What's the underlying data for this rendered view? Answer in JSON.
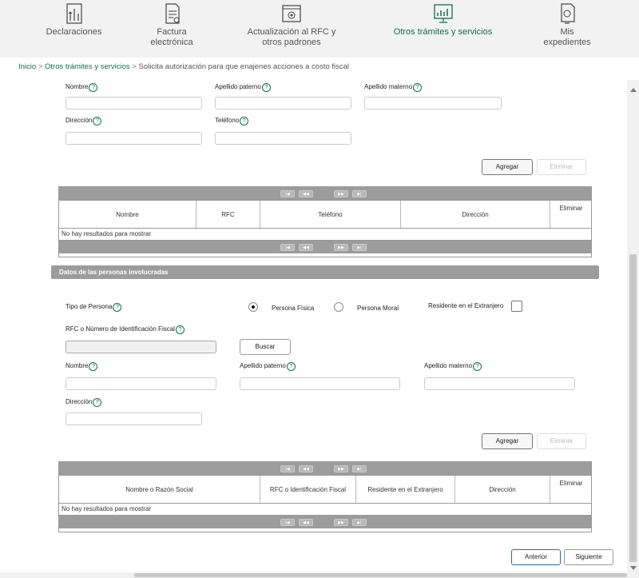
{
  "nav": {
    "items": [
      {
        "label1": "Declaraciones",
        "label2": "",
        "icon": "documents-stack-icon"
      },
      {
        "label1": "Factura",
        "label2": "electrónica",
        "icon": "invoice-icon"
      },
      {
        "label1": "Actualización al RFC y",
        "label2": "otros padrones",
        "icon": "rfc-update-icon"
      },
      {
        "label1": "Otros trámites y servicios",
        "label2": "",
        "icon": "services-monitor-icon"
      },
      {
        "label1": "Mis",
        "label2": "expedientes",
        "icon": "file-folder-icon"
      }
    ],
    "active_color": "#10704a"
  },
  "breadcrumb": {
    "home": "Inicio",
    "parent": "Otros trámites y servicios",
    "current": "Solicita autorización para que enajenes acciones a costo fiscal",
    "separator": ">"
  },
  "form1": {
    "nombre": "Nombre",
    "apellido_paterno": "Apellido paterno",
    "apellido_materno": "Apellido materno",
    "direccion": "Dirección",
    "telefono": "Teléfono",
    "help_glyph": "?",
    "agregar": "Agregar",
    "eliminar": "Eliminar"
  },
  "table1": {
    "columns": [
      "Nombre",
      "RFC",
      "Teléfono",
      "Dirección",
      "Eliminar"
    ],
    "empty": "No hay resultados para mostrar",
    "pager": [
      "|◀",
      "◀◀",
      "▶▶",
      "▶|"
    ]
  },
  "section2": {
    "title": "Datos de las personas involucradas",
    "tipo_persona": "Tipo de Persona",
    "persona_fisica": "Persona Física",
    "persona_moral": "Persona Moral",
    "residente": "Residente en el Extranjero",
    "rfc_label": "RFC o Número de Identificación Fiscal",
    "buscar": "Buscar",
    "nombre": "Nombre",
    "apellido_paterno": "Apellido paterno",
    "apellido_materno": "Apellido materno",
    "direccion": "Dirección",
    "agregar": "Agregar",
    "eliminar": "Eliminar"
  },
  "table2": {
    "columns": [
      "Nombre o Razón Social",
      "RFC o Identificación Fiscal",
      "Residente en el Extranjero",
      "Dirección",
      "Eliminar"
    ],
    "empty": "No hay resultados para mostrar",
    "pager": [
      "|◀",
      "◀◀",
      "▶▶",
      "▶|"
    ]
  },
  "footer": {
    "anterior": "Anterior",
    "siguiente": "Siguiente"
  }
}
